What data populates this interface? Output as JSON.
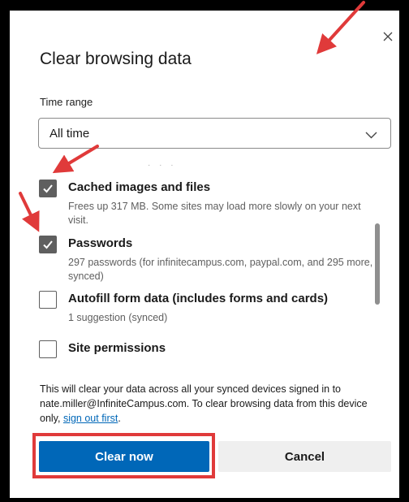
{
  "dialog": {
    "title": "Clear browsing data",
    "close_icon": "close-icon"
  },
  "time_range": {
    "label": "Time range",
    "selected": "All time",
    "icon": "chevron-down-icon"
  },
  "items": [
    {
      "title": "Cached images and files",
      "description": "Frees up 317 MB. Some sites may load more slowly on your next visit.",
      "checked": true
    },
    {
      "title": "Passwords",
      "description": "297 passwords (for infinitecampus.com, paypal.com, and 295 more, synced)",
      "checked": true
    },
    {
      "title": "Autofill form data (includes forms and cards)",
      "description": "1 suggestion (synced)",
      "checked": false
    },
    {
      "title": "Site permissions",
      "description": "",
      "checked": false
    }
  ],
  "note": {
    "text": "This will clear your data across all your synced devices signed in to nate.miller@InfiniteCampus.com. To clear browsing data from this device only, ",
    "link": "sign out first",
    "suffix": "."
  },
  "buttons": {
    "clear": "Clear now",
    "cancel": "Cancel"
  },
  "colors": {
    "accent": "#0067b8",
    "annotation": "#e03a3a",
    "checkbox": "#5f5f5f"
  }
}
